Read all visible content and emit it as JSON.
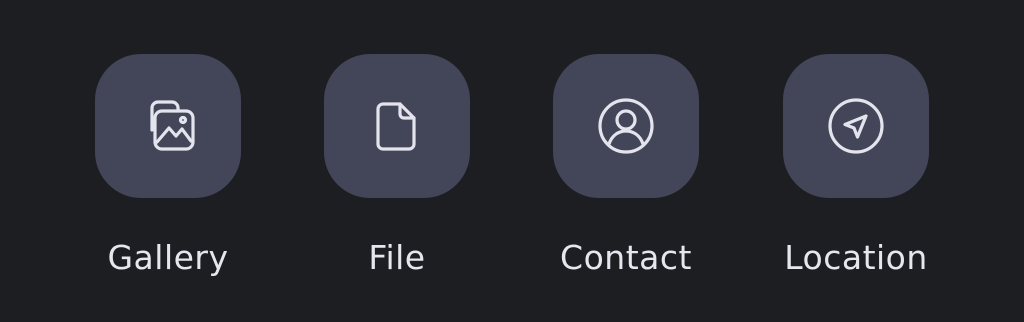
{
  "attach_options": [
    {
      "id": "gallery",
      "label": "Gallery",
      "icon": "gallery-icon"
    },
    {
      "id": "file",
      "label": "File",
      "icon": "file-icon"
    },
    {
      "id": "contact",
      "label": "Contact",
      "icon": "contact-icon"
    },
    {
      "id": "location",
      "label": "Location",
      "icon": "location-icon"
    }
  ],
  "colors": {
    "background": "#1d1e22",
    "tile": "#434658",
    "icon_stroke": "#e4e4ee",
    "label": "#e6e7ee"
  }
}
